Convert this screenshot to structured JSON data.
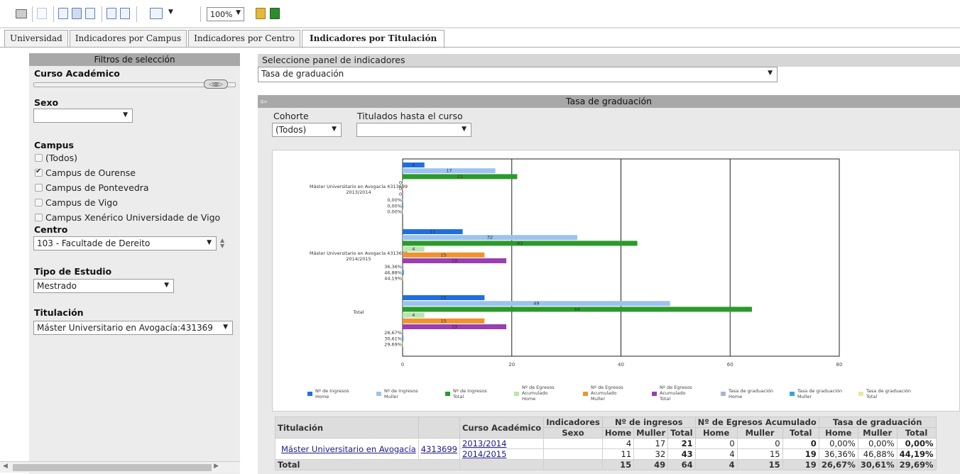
{
  "toolbar": {
    "zoom": "100%"
  },
  "tabs": [
    "Universidad",
    "Indicadores por Campus",
    "Indicadores por Centro",
    "Indicadores por Titulación"
  ],
  "filters": {
    "title": "Filtros de selección",
    "curso_label": "Curso Académico",
    "sexo_label": "Sexo",
    "sexo_value": "",
    "campus_label": "Campus",
    "campus_options": [
      {
        "label": "(Todos)",
        "checked": false
      },
      {
        "label": "Campus de Ourense",
        "checked": true
      },
      {
        "label": "Campus de Pontevedra",
        "checked": false
      },
      {
        "label": "Campus de Vigo",
        "checked": false
      },
      {
        "label": "Campus Xenérico Universidade de Vigo",
        "checked": false
      }
    ],
    "centro_label": "Centro",
    "centro_value": "103 - Facultade de Dereito",
    "tipo_label": "Tipo de Estudio",
    "tipo_value": "Mestrado",
    "titulacion_label": "Titulación",
    "titulacion_value": "Máster Universitario en Avogacía:431369"
  },
  "panel": {
    "label": "Seleccione panel de indicadores",
    "value": "Tasa de graduación"
  },
  "chart_header": "Tasa de graduación",
  "chart_filters": {
    "cohorte_label": "Cohorte",
    "cohorte_value": "(Todos)",
    "titulados_label": "Titulados hasta el curso",
    "titulados_value": ""
  },
  "colors": {
    "ingresos_home": "#1f6fe0",
    "ingresos_muller": "#9cc3ef",
    "ingresos_total": "#2b9a2b",
    "egresos_home": "#b8e6b0",
    "egresos_muller": "#f0922f",
    "egresos_total": "#9a3fb0",
    "tasa_home": "#a8b4cf",
    "tasa_muller": "#3aa3e0",
    "tasa_total": "#eee79a"
  },
  "chart_data": {
    "type": "bar",
    "orientation": "horizontal",
    "xlim": [
      0,
      80
    ],
    "xticks": [
      0,
      20,
      40,
      60,
      80
    ],
    "grid": true,
    "legend_position": "bottom",
    "categories": [
      "Máster Universitario en Avogacía 4313699 2013/2014",
      "Máster Universitario en Avogacía 4313699 2014/2015",
      "Total"
    ],
    "category_lines": [
      [
        "Máster Universitario en Avogacía 4313699",
        "2013/2014"
      ],
      [
        "Máster Universitario en Avogacía 4313699",
        "2014/2015"
      ],
      [
        "Total"
      ]
    ],
    "series": [
      {
        "name": "Nº de Ingresos Home",
        "key": "ingresos_home",
        "values": [
          4,
          11,
          15
        ]
      },
      {
        "name": "Nº de Ingresos Muller",
        "key": "ingresos_muller",
        "values": [
          17,
          32,
          49
        ]
      },
      {
        "name": "Nº de Ingresos Total",
        "key": "ingresos_total",
        "values": [
          21,
          43,
          64
        ]
      },
      {
        "name": "Nº de Egresos Acumulado Home",
        "key": "egresos_home",
        "values": [
          0,
          4,
          4
        ]
      },
      {
        "name": "Nº de Egresos Acumulado Muller",
        "key": "egresos_muller",
        "values": [
          0,
          15,
          15
        ]
      },
      {
        "name": "Nº de Egresos Acumulado Total",
        "key": "egresos_total",
        "values": [
          0,
          19,
          19
        ]
      },
      {
        "name": "Tasa de graduación Home",
        "key": "tasa_home",
        "values": [
          0.0,
          0.3636,
          0.2667
        ],
        "labels": [
          "0,00%",
          "36,36%",
          "26,67%"
        ]
      },
      {
        "name": "Tasa de graduación Muller",
        "key": "tasa_muller",
        "values": [
          0.0,
          0.4688,
          0.3061
        ],
        "labels": [
          "0,00%",
          "46,88%",
          "30,61%"
        ]
      },
      {
        "name": "Tasa de graduación Total",
        "key": "tasa_total",
        "values": [
          0.0,
          0.4419,
          0.2969
        ],
        "labels": [
          "0,00%",
          "44,19%",
          "29,69%"
        ]
      }
    ],
    "legend": [
      [
        "Nº de Ingresos",
        "Home"
      ],
      [
        "Nº de Ingresos",
        "Muller"
      ],
      [
        "Nº de Ingresos",
        "Total"
      ],
      [
        "Nº de Egresos",
        "Acumulado",
        "Home"
      ],
      [
        "Nº de Egresos",
        "Acumulado",
        "Muller"
      ],
      [
        "Nº de Egresos",
        "Acumulado",
        "Total"
      ],
      [
        "Tasa de graduación",
        "Home"
      ],
      [
        "Tasa de graduación",
        "Muller"
      ],
      [
        "Tasa de graduación",
        "Total"
      ]
    ]
  },
  "table": {
    "headers": {
      "titulacion": "Titulación",
      "curso": "Curso Académico",
      "indicadores": "Indicadores",
      "sexo": "Sexo",
      "ingresos": "Nº de ingresos",
      "egresos": "Nº de Egresos Acumulado",
      "tasa": "Tasa de graduación",
      "home": "Home",
      "muller": "Muller",
      "total": "Total"
    },
    "titulacion_name": "Máster Universitario en Avogacía",
    "titulacion_code": "4313699",
    "rows": [
      {
        "curso": "2013/2014",
        "ih": "4",
        "im": "17",
        "it": "21",
        "eh": "0",
        "em": "0",
        "et": "0",
        "th": "0,00%",
        "tm": "0,00%",
        "tt": "0,00%"
      },
      {
        "curso": "2014/2015",
        "ih": "11",
        "im": "32",
        "it": "43",
        "eh": "4",
        "em": "15",
        "et": "19",
        "th": "36,36%",
        "tm": "46,88%",
        "tt": "44,19%"
      }
    ],
    "total": {
      "label": "Total",
      "ih": "15",
      "im": "49",
      "it": "64",
      "eh": "4",
      "em": "15",
      "et": "19",
      "th": "26,67%",
      "tm": "30,61%",
      "tt": "29,69%"
    }
  }
}
